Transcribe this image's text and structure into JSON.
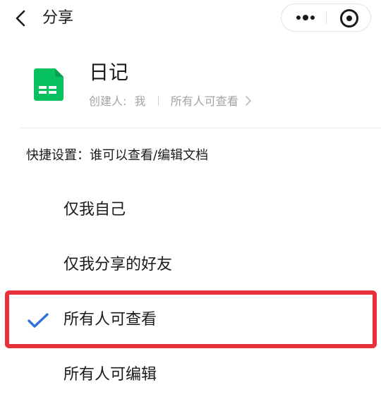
{
  "header": {
    "title": "分享",
    "back_icon": "chevron-left-icon",
    "more_icon": "more-dots-icon",
    "close_icon": "target-close-icon"
  },
  "document": {
    "title": "日记",
    "icon": "spreadsheet-doc-icon",
    "icon_color": "#07c160",
    "creator_label": "创建人:",
    "creator_value": "我",
    "permission_summary": "所有人可查看"
  },
  "quick_settings": {
    "label": "快捷设置：谁可以查看/编辑文档",
    "options": [
      {
        "label": "仅我自己",
        "selected": false
      },
      {
        "label": "仅我分享的好友",
        "selected": false
      },
      {
        "label": "所有人可查看",
        "selected": true
      },
      {
        "label": "所有人可编辑",
        "selected": false
      }
    ],
    "check_color": "#2f6fe4"
  },
  "highlight": {
    "color": "#e8313a"
  }
}
